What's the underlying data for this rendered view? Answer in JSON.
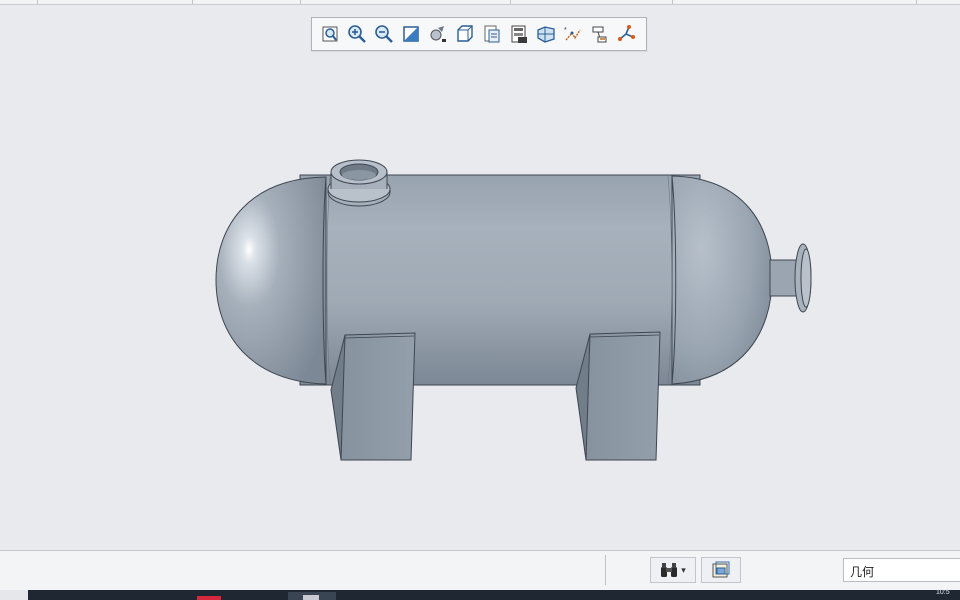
{
  "view_toolbar": {
    "buttons": [
      {
        "name": "refit-icon"
      },
      {
        "name": "zoom-in-icon"
      },
      {
        "name": "zoom-out-icon"
      },
      {
        "name": "repaint-icon"
      },
      {
        "name": "spin-center-icon"
      },
      {
        "name": "display-style-icon"
      },
      {
        "name": "saved-orientations-icon"
      },
      {
        "name": "view-manager-icon"
      },
      {
        "name": "perspective-view-icon"
      },
      {
        "name": "datum-display-icon"
      },
      {
        "name": "annotation-display-icon"
      },
      {
        "name": "sketch-display-icon"
      }
    ]
  },
  "model": {
    "description_color": "#a3adb8",
    "shadow_color": "#6f7a86"
  },
  "statusbar": {
    "find_icon": "binoculars-icon",
    "find_dropdown": "▾",
    "box_icon": "box-select-icon",
    "filter_value": "几何"
  },
  "taskbar": {
    "clock": "10:5"
  }
}
